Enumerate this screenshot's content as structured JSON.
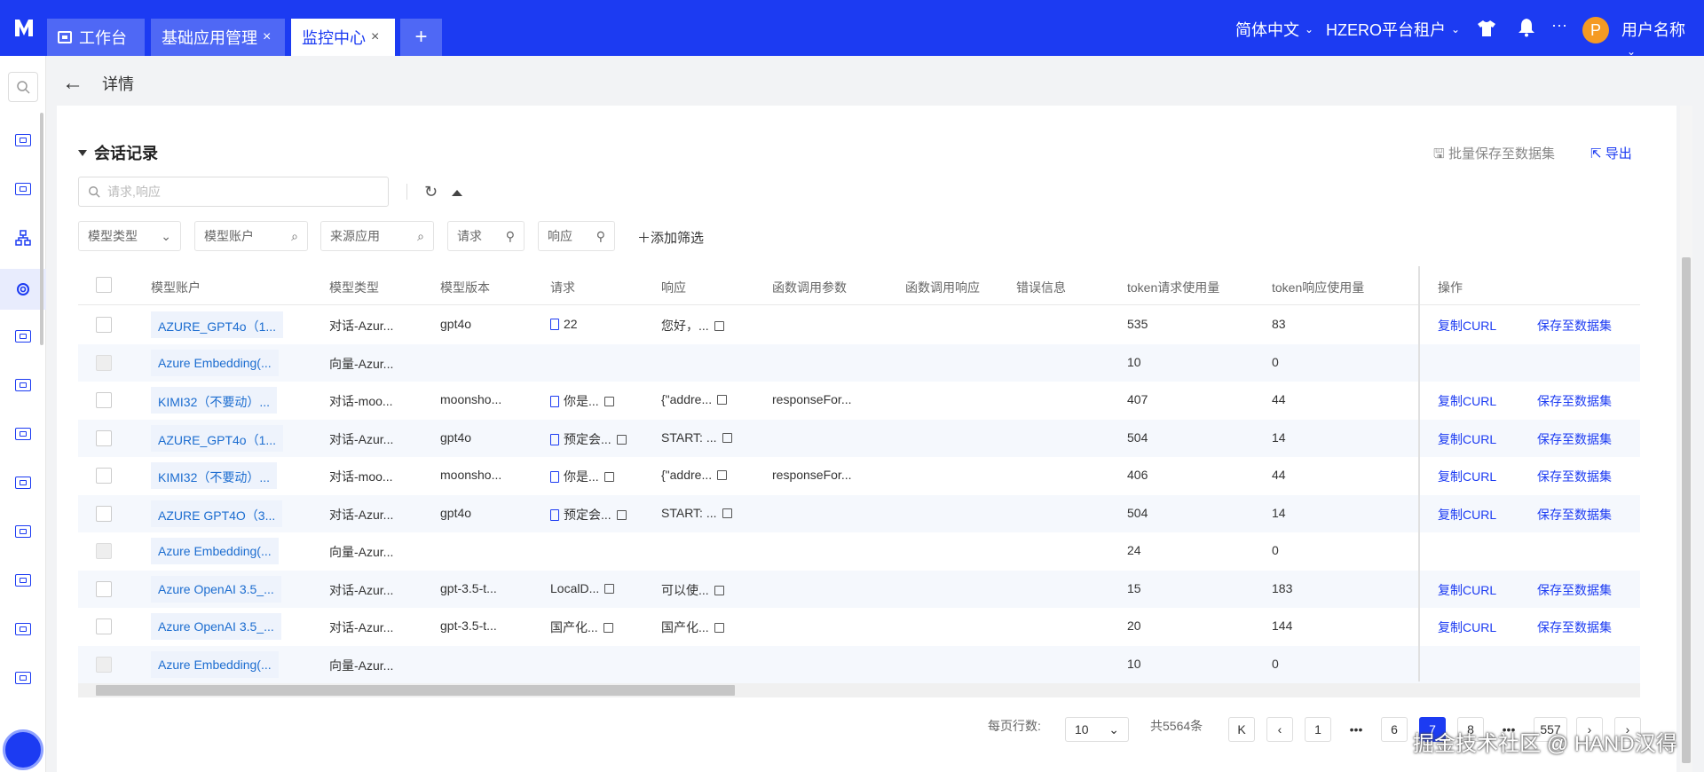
{
  "topbar": {
    "tabs": [
      {
        "label": "工作台",
        "closable": false
      },
      {
        "label": "基础应用管理",
        "closable": true
      },
      {
        "label": "监控中心",
        "closable": true,
        "active": true
      }
    ],
    "add_tab": "+",
    "close_glyph": "×",
    "language": "简体中文",
    "tenant": "HZERO平台租户",
    "avatar_letter": "P",
    "username": "用户名称",
    "more": "···"
  },
  "header": {
    "back": "←",
    "title": "详情"
  },
  "section": {
    "title": "会话记录",
    "batch_save": "批量保存至数据集",
    "export": "导出"
  },
  "search": {
    "placeholder": "请求,响应"
  },
  "filters": [
    "模型类型",
    "模型账户",
    "来源应用",
    "请求",
    "响应"
  ],
  "add_filter": "添加筛选",
  "table": {
    "columns": [
      "模型账户",
      "模型类型",
      "模型版本",
      "请求",
      "响应",
      "函数调用参数",
      "函数调用响应",
      "错误信息",
      "token请求使用量",
      "token响应使用量",
      "操作"
    ],
    "actions": {
      "copy": "复制CURL",
      "save": "保存至数据集"
    },
    "rows": [
      {
        "account": "AZURE_GPT4o（1...",
        "type": "对话-Azur...",
        "version": "gpt4o",
        "request": "22",
        "request_doc": true,
        "response": "您好，...",
        "func_args": "",
        "req_tokens": "535",
        "resp_tokens": "83",
        "actions": true,
        "disabled": false
      },
      {
        "account": "Azure Embedding(...",
        "type": "向量-Azur...",
        "version": "",
        "request": "",
        "request_doc": false,
        "response": "",
        "func_args": "",
        "req_tokens": "10",
        "resp_tokens": "0",
        "actions": false,
        "disabled": true
      },
      {
        "account": "KIMI32（不要动）...",
        "type": "对话-moo...",
        "version": "moonsho...",
        "request": "你是...",
        "request_doc": true,
        "response": "{\"addre...",
        "func_args": "responseFor...",
        "req_tokens": "407",
        "resp_tokens": "44",
        "actions": true,
        "disabled": false
      },
      {
        "account": "AZURE_GPT4o（1...",
        "type": "对话-Azur...",
        "version": "gpt4o",
        "request": "预定会...",
        "request_doc": true,
        "response": "START: ...",
        "func_args": "",
        "req_tokens": "504",
        "resp_tokens": "14",
        "actions": true,
        "disabled": false
      },
      {
        "account": "KIMI32（不要动）...",
        "type": "对话-moo...",
        "version": "moonsho...",
        "request": "你是...",
        "request_doc": true,
        "response": "{\"addre...",
        "func_args": "responseFor...",
        "req_tokens": "406",
        "resp_tokens": "44",
        "actions": true,
        "disabled": false
      },
      {
        "account": "AZURE GPT4O（3...",
        "type": "对话-Azur...",
        "version": "gpt4o",
        "request": "预定会...",
        "request_doc": true,
        "response": "START: ...",
        "func_args": "",
        "req_tokens": "504",
        "resp_tokens": "14",
        "actions": true,
        "disabled": false
      },
      {
        "account": "Azure Embedding(...",
        "type": "向量-Azur...",
        "version": "",
        "request": "",
        "request_doc": false,
        "response": "",
        "func_args": "",
        "req_tokens": "24",
        "resp_tokens": "0",
        "actions": false,
        "disabled": true
      },
      {
        "account": "Azure OpenAI 3.5_...",
        "type": "对话-Azur...",
        "version": "gpt-3.5-t...",
        "request": "LocalD...",
        "request_doc": false,
        "response": "可以使...",
        "func_args": "",
        "req_tokens": "15",
        "resp_tokens": "183",
        "actions": true,
        "disabled": false
      },
      {
        "account": "Azure OpenAI 3.5_...",
        "type": "对话-Azur...",
        "version": "gpt-3.5-t...",
        "request": "国产化...",
        "request_doc": false,
        "response": "国产化...",
        "func_args": "",
        "req_tokens": "20",
        "resp_tokens": "144",
        "actions": true,
        "disabled": false
      },
      {
        "account": "Azure Embedding(...",
        "type": "向量-Azur...",
        "version": "",
        "request": "",
        "request_doc": false,
        "response": "",
        "func_args": "",
        "req_tokens": "10",
        "resp_tokens": "0",
        "actions": false,
        "disabled": true
      }
    ]
  },
  "pagination": {
    "rows_per_page_label": "每页行数:",
    "rows_per_page": "10",
    "total": "共5564条",
    "first": "K",
    "prev": "‹",
    "pages": [
      "1",
      "•••",
      "6",
      "7",
      "8",
      "•••",
      "557"
    ],
    "current": "7",
    "next": "›",
    "last": "›"
  },
  "watermark": "掘金技术社区 @ HAND汉得",
  "colors": {
    "brand": "#1c3bf2",
    "link": "#1c6dd0"
  }
}
